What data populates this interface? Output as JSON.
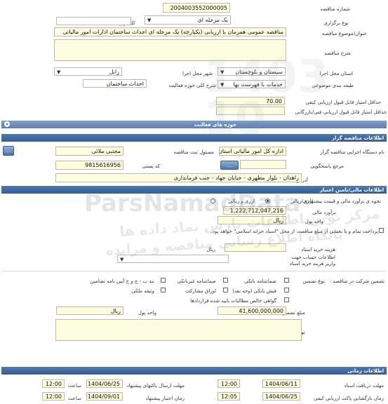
{
  "form": {
    "tender_number_label": "شماره مناقصه",
    "tender_number": "2004003552000005",
    "hold_type_label": "نوع برگزاری",
    "hold_type": "یک مرحله ای",
    "keyword_label": "کلید واژه",
    "title_label": "عنوان/موضوع مناقصه",
    "title": "مناقصه عمومی همزمان با ارزیابی (یکپارچه) یک مرحله ای احداث ساختمان ادارات امور مالیاتی",
    "description_label": "شرح مناقصه",
    "province_label": "استان محل اجرا",
    "province": "سیستان و بلوچستان",
    "city_label": "شهر محل اجرا",
    "city": "زابل",
    "category_label": "طبقه بندی موضوعی",
    "category": "خدمات با فهرست بها",
    "activity_label": "شرح کلی حوزه فعالیت",
    "activity": "احداث ساختمان",
    "min_quality_label": "حداقل امتیاز قابل قبول ارزیابی کیفی",
    "min_quality": "70.00",
    "min_tech_label": "حداقل امتیاز قابل قبول ارزیابی فنی/بازرگانی",
    "activity_bar": "حوزه های فعالیت"
  },
  "organizer": {
    "bar": "اطلاعات مناقصه گزار",
    "org_label": "نام دستگاه اجرایی مناقصه گزار",
    "org_value": "اداره کل امور مالیاتی استان",
    "manager_label": "مسئول ثبت مناقصه",
    "manager_value": "مجتبی ملائی",
    "response_label": "مرجع پاسخگویی",
    "postal_label": "کد پستی",
    "postal_value": "9815616956",
    "address_label": "آدرس",
    "address_value": "زاهدان - بلوار مطهری - خیابان جهاد - جنب فرمانداری",
    "button_dots": "..."
  },
  "finance": {
    "bar": "اطلاعات مالی/تامین اعتبار",
    "estimate_label": "نحوه ی برآورد مالی و قیمت پیشنهادی",
    "opt_rial": "ارزی/ریالی",
    "opt_fx": "ارزی و ریالی",
    "estimate_amount_label": "برآورد مالی",
    "estimate_amount": "1,222,712,047,216",
    "unit_label": "واحد پول",
    "unit_value": "ریال",
    "payment_note": "پرداخت تمام و یا بخشی از مبلغ مناقصه، از محل \"اسناد خزانه اسلامی\" خواهد بود.",
    "doc_price_label": "هزینه خرید اسناد",
    "doc_price_unit": "ریال",
    "account_label": "اطلاعات حساب جهت واریز هزینه خرید اسناد"
  },
  "guarantee": {
    "section_label": "تضمین شرکت در مناقصه :",
    "type_label": "نوع تضمین",
    "opt_bank": "ضمانتنامه بانکی",
    "opt_nonbank": "ضمانتنامه غیربانکی",
    "opt_insurance": "بند ب - ج و خ آیین نامه تضامین",
    "opt_check": "فیش بانکی (وجه نقد)",
    "opt_bonds": "اوراق مشارکت",
    "opt_property": "وثیقه ملکی",
    "opt_receivables": "گواهی خالص مطالبات تایید شده قراردادها",
    "amount_label": "مبلغ تضمین",
    "amount_value": "41,600,000,000",
    "unit_label": "واحد پول",
    "unit_value": "ریال",
    "notes_label": "توضیحات"
  },
  "timing": {
    "bar": "اطلاعات زمانی",
    "receive_label": "مهلت دریافت اسناد",
    "receive_date": "1404/06/11",
    "receive_time": "12:00",
    "send_label": "مهلت ارسال پاکتهای پیشنهاد",
    "send_date": "1404/06/25",
    "send_time": "12:00",
    "open_label": "زمان بازگشایی پاکت ارزیابی کیفی",
    "open_date": "1404/06/25",
    "open_time": "12:05",
    "validity_label": "زمان اعتبار پیشنهاد",
    "validity_date": "1404/09/01",
    "validity_time": "12:00",
    "time_label": "ساعت"
  },
  "watermark": {
    "brand": "ParsNamadData",
    "line1": "مرکز نوین اطلاعات پارس نماد داده ها",
    "line2": "پایگاه اطلاع رسانی مناقصه و مزایده"
  }
}
